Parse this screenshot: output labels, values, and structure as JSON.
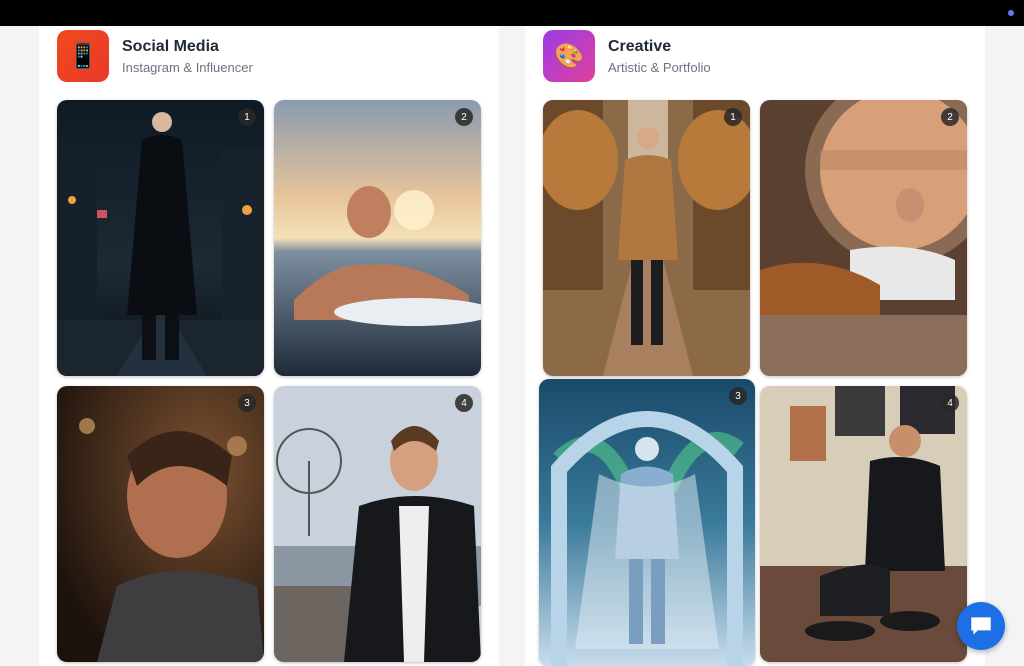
{
  "categories": [
    {
      "title": "Social Media",
      "subtitle": "Instagram & Influencer",
      "icon": "phone-icon",
      "accent": "#f04a1d",
      "images": [
        {
          "badge": "1",
          "scene": "man in long coat on rainy night street"
        },
        {
          "badge": "2",
          "scene": "man in ocean with surfboard at sunset"
        },
        {
          "badge": "3",
          "scene": "profile portrait in warm bokeh light"
        },
        {
          "badge": "4",
          "scene": "man in black coat by ferris wheel"
        }
      ]
    },
    {
      "title": "Creative",
      "subtitle": "Artistic & Portfolio",
      "icon": "palette-icon",
      "accent": "#9b3be8",
      "images": [
        {
          "badge": "1",
          "scene": "man walking autumn tree path"
        },
        {
          "badge": "2",
          "scene": "man relaxing on sofa by round window"
        },
        {
          "badge": "3",
          "scene": "ice king in armor under aurora arch"
        },
        {
          "badge": "4",
          "scene": "man in turtleneck sitting with records"
        }
      ]
    }
  ],
  "chat_button": {
    "icon": "chat-icon"
  }
}
